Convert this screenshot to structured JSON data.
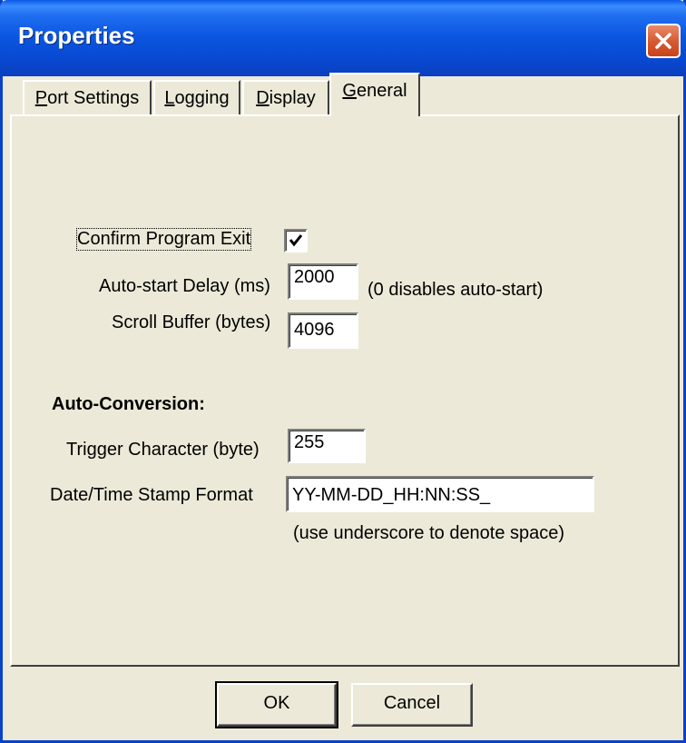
{
  "window": {
    "title": "Properties"
  },
  "tabs": [
    {
      "label": "Port Settings",
      "mnemonic": "P",
      "rest": "ort Settings",
      "selected": false
    },
    {
      "label": "Logging",
      "mnemonic": "L",
      "rest": "ogging",
      "selected": false
    },
    {
      "label": "Display",
      "mnemonic": "D",
      "rest": "isplay",
      "selected": false
    },
    {
      "label": "General",
      "mnemonic": "G",
      "rest": "eneral",
      "selected": true
    }
  ],
  "general": {
    "confirm_exit_label": "Confirm Program Exit",
    "confirm_exit_checked": true,
    "autostart_label": "Auto-start Delay (ms)",
    "autostart_value": "2000",
    "autostart_hint": "(0 disables auto-start)",
    "scroll_buffer_label": "Scroll Buffer (bytes)",
    "scroll_buffer_value": "4096",
    "auto_conversion_heading": "Auto-Conversion:",
    "trigger_label": "Trigger Character (byte)",
    "trigger_value": "255",
    "datetime_label": "Date/Time Stamp Format",
    "datetime_value": "YY-MM-DD_HH:NN:SS_",
    "datetime_hint": "(use underscore to denote space)"
  },
  "buttons": {
    "ok": "OK",
    "cancel": "Cancel"
  },
  "colors": {
    "titlebar": "#0a55df",
    "dialog_face": "#ece9d8",
    "close_button": "#d65c33"
  },
  "icons": {
    "close": "close-icon",
    "check": "checkmark-icon"
  }
}
